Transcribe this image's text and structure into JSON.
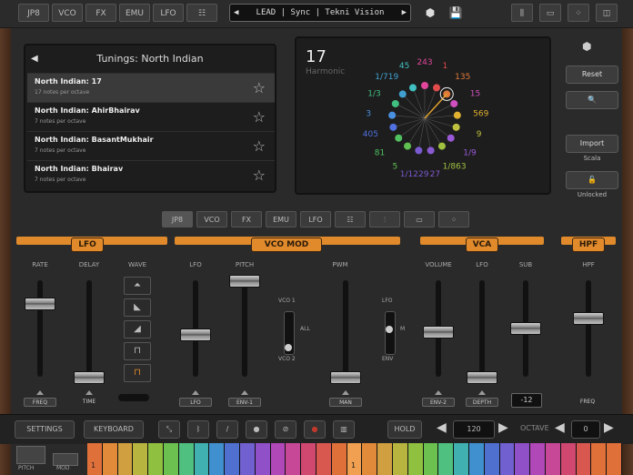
{
  "topbar": {
    "tabs": [
      "JP8",
      "VCO",
      "FX",
      "EMU",
      "LFO"
    ],
    "grid_icon": "grid-icon",
    "preset": "LEAD | Sync | Tekni Vision",
    "preset_icon": "chevron-left-icon",
    "right_icons": [
      "sliders-icon",
      "window-icon",
      "dots-grid-icon",
      "panel-icon"
    ]
  },
  "tunings": {
    "title": "Tunings: North Indian",
    "items": [
      {
        "name": "North Indian: 17",
        "sub": "17 notes per octave"
      },
      {
        "name": "North Indian: AhirBhairav",
        "sub": "7 notes per octave"
      },
      {
        "name": "North Indian: BasantMukhair",
        "sub": "7 notes per octave"
      },
      {
        "name": "North Indian: Bhairav",
        "sub": "7 notes per octave"
      }
    ]
  },
  "harmonic": {
    "number": "17",
    "label": "Harmonic",
    "ratios": [
      {
        "t": "243",
        "c": "#e0459a"
      },
      {
        "t": "1",
        "c": "#e04b4b"
      },
      {
        "t": "135",
        "c": "#e07a3a"
      },
      {
        "t": "15",
        "c": "#d050c0"
      },
      {
        "t": "569",
        "c": "#e0b030"
      },
      {
        "t": "9",
        "c": "#c0c040"
      },
      {
        "t": "1/9",
        "c": "#9a5ad8"
      },
      {
        "t": "1/863",
        "c": "#a0c040"
      },
      {
        "t": "27",
        "c": "#8a5ad0"
      },
      {
        "t": "1/1229",
        "c": "#7a5ad0"
      },
      {
        "t": "5",
        "c": "#60c050"
      },
      {
        "t": "81",
        "c": "#50c060"
      },
      {
        "t": "405",
        "c": "#5070e0"
      },
      {
        "t": "3",
        "c": "#4a90e0"
      },
      {
        "t": "1/3",
        "c": "#40c080"
      },
      {
        "t": "1/719",
        "c": "#40a0d0"
      },
      {
        "t": "45",
        "c": "#40c0c0"
      }
    ]
  },
  "side": {
    "reset": "Reset",
    "import": "Import",
    "scala": "Scala",
    "unlocked": "Unlocked"
  },
  "midtabs": [
    "JP8",
    "VCO",
    "FX",
    "EMU",
    "LFO"
  ],
  "sections": {
    "lfo": "LFO",
    "vco_mod": "VCO MOD",
    "vca": "VCA",
    "hpf": "HPF"
  },
  "params": {
    "rate": "RATE",
    "delay": "DELAY",
    "wave": "WAVE",
    "lfo": "LFO",
    "pitch": "PITCH",
    "pwm": "PWM",
    "volume": "VOLUME",
    "lfo2": "LFO",
    "sub": "SUB",
    "hpf": "HPF",
    "vco1": "VCO 1",
    "all": "ALL",
    "vco2": "VCO 2",
    "lfo3": "LFO",
    "m": "M",
    "env": "ENV"
  },
  "mods": {
    "freq": "FREQ",
    "time": "TIME",
    "lfo": "LFO",
    "env1": "ENV-1",
    "man": "MAN",
    "env2": "ENV-2",
    "depth": "DEPTH",
    "octave_shift": "-12",
    "freq2": "FREQ"
  },
  "bottom": {
    "settings": "SETTINGS",
    "keyboard": "KEYBOARD",
    "hold": "HOLD",
    "bpm": "120",
    "octave_label": "OCTAVE",
    "octave": "0",
    "pitch": "PITCH",
    "mod": "MOD"
  },
  "keys": {
    "marker_left": "1",
    "marker_right": "1"
  }
}
